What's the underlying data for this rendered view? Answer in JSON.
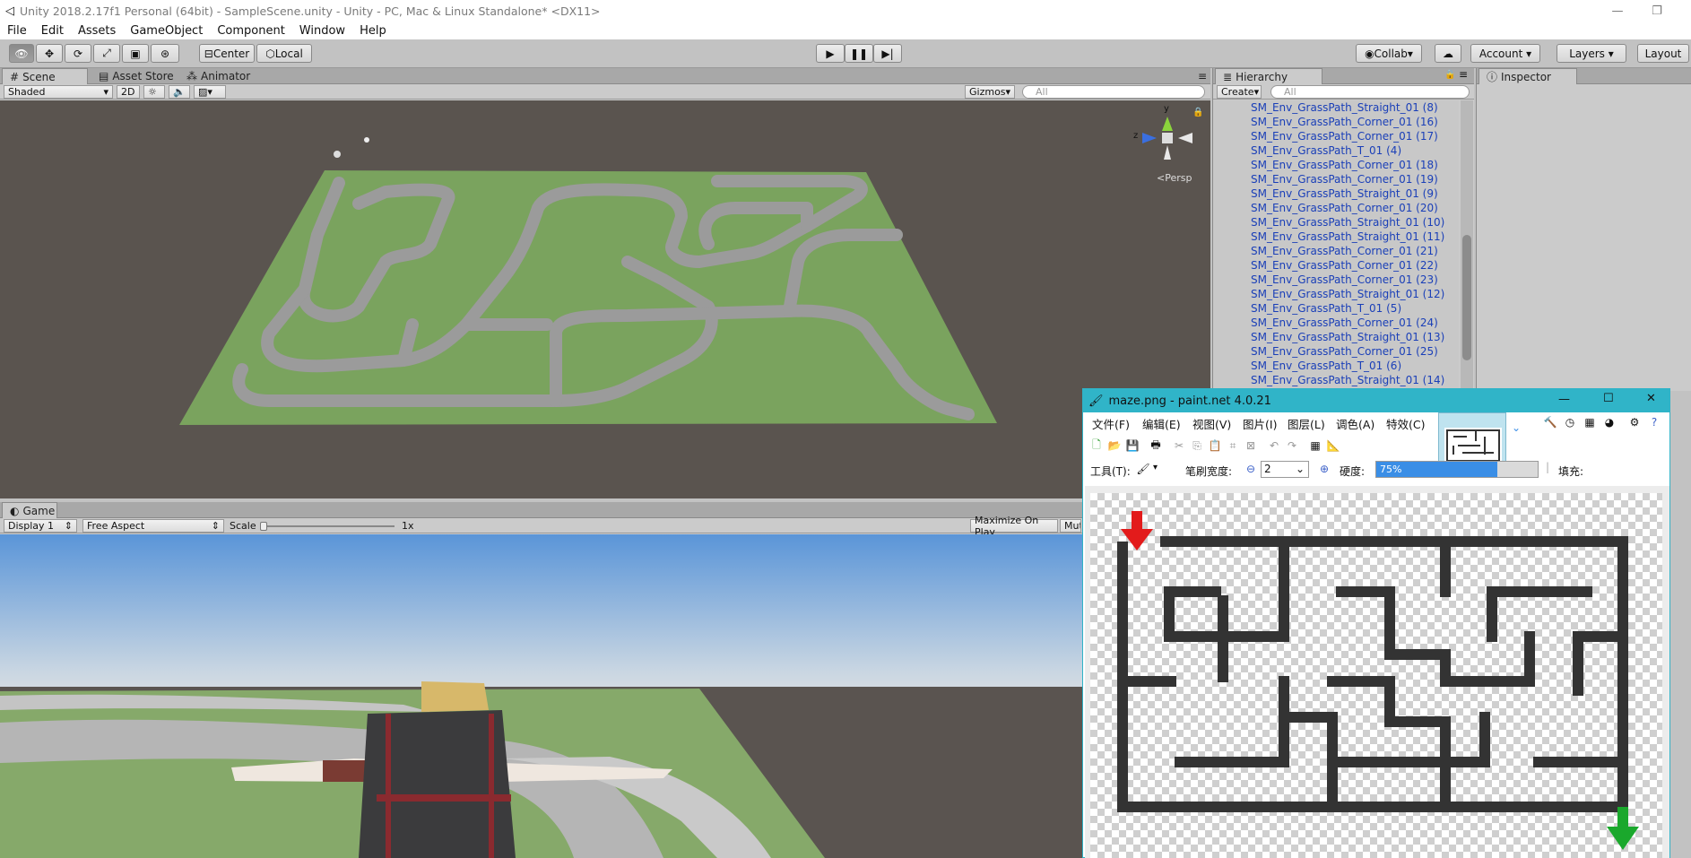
{
  "window": {
    "title": "Unity 2018.2.17f1 Personal (64bit) - SampleScene.unity - Unity - PC, Mac & Linux Standalone* <DX11>"
  },
  "menu": [
    "File",
    "Edit",
    "Assets",
    "GameObject",
    "Component",
    "Window",
    "Help"
  ],
  "toolbar": {
    "center": "Center",
    "local": "Local",
    "collab": "Collab",
    "account": "Account",
    "layers": "Layers",
    "layout": "Layout"
  },
  "scene": {
    "tabs": [
      "Scene",
      "Asset Store",
      "Animator"
    ],
    "shading": "Shaded",
    "mode2d": "2D",
    "gizmos": "Gizmos",
    "search_placeholder": "All",
    "axis_y": "y",
    "axis_z": "z",
    "persp": "Persp"
  },
  "game": {
    "tab": "Game",
    "display": "Display 1",
    "aspect": "Free Aspect",
    "scale_label": "Scale",
    "scale_value": "1x",
    "maximize": "Maximize On Play",
    "mute": "Mute"
  },
  "hierarchy": {
    "tab": "Hierarchy",
    "create": "Create",
    "search_placeholder": "All",
    "items": [
      "SM_Env_GrassPath_Straight_01 (8)",
      "SM_Env_GrassPath_Corner_01 (16)",
      "SM_Env_GrassPath_Corner_01 (17)",
      "SM_Env_GrassPath_T_01 (4)",
      "SM_Env_GrassPath_Corner_01 (18)",
      "SM_Env_GrassPath_Corner_01 (19)",
      "SM_Env_GrassPath_Straight_01 (9)",
      "SM_Env_GrassPath_Corner_01 (20)",
      "SM_Env_GrassPath_Straight_01 (10)",
      "SM_Env_GrassPath_Straight_01 (11)",
      "SM_Env_GrassPath_Corner_01 (21)",
      "SM_Env_GrassPath_Corner_01 (22)",
      "SM_Env_GrassPath_Corner_01 (23)",
      "SM_Env_GrassPath_Straight_01 (12)",
      "SM_Env_GrassPath_T_01 (5)",
      "SM_Env_GrassPath_Corner_01 (24)",
      "SM_Env_GrassPath_Straight_01 (13)",
      "SM_Env_GrassPath_Corner_01 (25)",
      "SM_Env_GrassPath_T_01 (6)",
      "SM_Env_GrassPath_Straight_01 (14)"
    ]
  },
  "inspector": {
    "tab": "Inspector"
  },
  "paintnet": {
    "title": "maze.png - paint.net 4.0.21",
    "menu": [
      "文件(F)",
      "编辑(E)",
      "视图(V)",
      "图片(I)",
      "图层(L)",
      "调色(A)",
      "特效(C)"
    ],
    "tool_label": "工具(T):",
    "brush_width_label": "笔刷宽度:",
    "brush_width": "2",
    "hardness_label": "硬度:",
    "hardness": "75%",
    "hardness_fraction": 0.75,
    "fill_label": "填充:"
  },
  "colors": {
    "accent_blue": "#3a8ee6",
    "hierarchy_text": "#1a3fb8",
    "pdn_title": "#30b4c8",
    "grass": "#7aa35e",
    "road": "#9a9a9a",
    "arrow_red": "#e31b1b",
    "arrow_green": "#1aa82c"
  }
}
